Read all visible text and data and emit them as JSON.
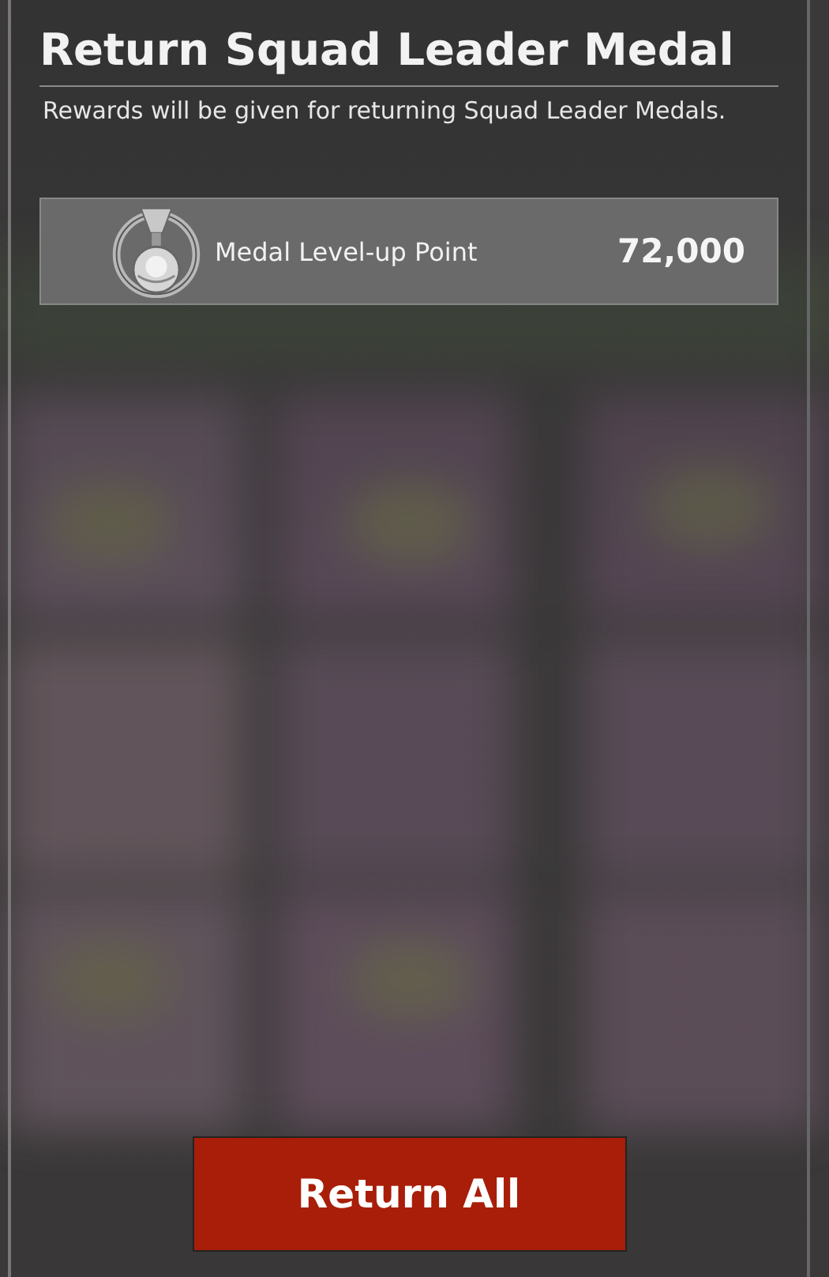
{
  "dialog": {
    "title": "Return Squad Leader Medal",
    "description": "Rewards will be given for returning Squad Leader Medals."
  },
  "rewards": [
    {
      "label": "Medal Level-up Point",
      "amount": "72,000"
    }
  ],
  "buttons": [
    {
      "label": "Return All",
      "kind": "primary"
    }
  ]
}
